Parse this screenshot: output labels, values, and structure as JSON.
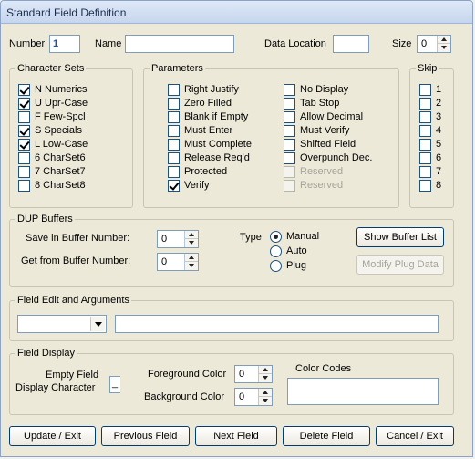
{
  "window": {
    "title": "Standard Field Definition"
  },
  "top": {
    "number_label": "Number",
    "number_value": "1",
    "name_label": "Name",
    "name_value": "",
    "data_location_label": "Data Location",
    "data_location_value": "",
    "size_label": "Size",
    "size_value": "0"
  },
  "character_sets": {
    "legend": "Character Sets",
    "items": [
      {
        "label": "N  Numerics",
        "checked": true
      },
      {
        "label": "U  Upr-Case",
        "checked": true
      },
      {
        "label": "F  Few-Spcl",
        "checked": false
      },
      {
        "label": "S  Specials",
        "checked": true
      },
      {
        "label": "L  Low-Case",
        "checked": true
      },
      {
        "label": "6  CharSet6",
        "checked": false
      },
      {
        "label": "7  CharSet7",
        "checked": false
      },
      {
        "label": "8  CharSet8",
        "checked": false
      }
    ]
  },
  "parameters": {
    "legend": "Parameters",
    "col1": [
      {
        "label": "Right Justify",
        "checked": false,
        "disabled": false
      },
      {
        "label": "Zero Filled",
        "checked": false,
        "disabled": false
      },
      {
        "label": "Blank if Empty",
        "checked": false,
        "disabled": false
      },
      {
        "label": "Must Enter",
        "checked": false,
        "disabled": false
      },
      {
        "label": "Must Complete",
        "checked": false,
        "disabled": false
      },
      {
        "label": "Release Req'd",
        "checked": false,
        "disabled": false
      },
      {
        "label": "Protected",
        "checked": false,
        "disabled": false
      },
      {
        "label": "Verify",
        "checked": true,
        "disabled": false
      }
    ],
    "col2": [
      {
        "label": "No Display",
        "checked": false,
        "disabled": false
      },
      {
        "label": "Tab Stop",
        "checked": false,
        "disabled": false
      },
      {
        "label": "Allow Decimal",
        "checked": false,
        "disabled": false
      },
      {
        "label": "Must Verify",
        "checked": false,
        "disabled": false
      },
      {
        "label": "Shifted Field",
        "checked": false,
        "disabled": false
      },
      {
        "label": "Overpunch Dec.",
        "checked": false,
        "disabled": false
      },
      {
        "label": "Reserved",
        "checked": false,
        "disabled": true
      },
      {
        "label": "Reserved",
        "checked": false,
        "disabled": true
      }
    ]
  },
  "skip": {
    "legend": "Skip",
    "items": [
      "1",
      "2",
      "3",
      "4",
      "5",
      "6",
      "7",
      "8"
    ]
  },
  "dup_buffers": {
    "legend": "DUP Buffers",
    "save_label": "Save in Buffer Number:",
    "save_value": "0",
    "get_label": "Get from Buffer Number:",
    "get_value": "0",
    "type_label": "Type",
    "types": [
      {
        "label": "Manual",
        "selected": true
      },
      {
        "label": "Auto",
        "selected": false
      },
      {
        "label": "Plug",
        "selected": false
      }
    ],
    "show_buffer_list": "Show Buffer List",
    "modify_plug_data": "Modify Plug Data"
  },
  "field_edit": {
    "legend": "Field Edit and Arguments",
    "combo_value": "",
    "args_value": ""
  },
  "field_display": {
    "legend": "Field Display",
    "empty_field_label_1": "Empty Field",
    "empty_field_label_2": "Display Character",
    "empty_char_value": "_",
    "foreground_label": "Foreground Color",
    "foreground_value": "0",
    "background_label": "Background Color",
    "background_value": "0",
    "color_codes_label": "Color Codes"
  },
  "buttons": {
    "update_exit": "Update / Exit",
    "previous_field": "Previous Field",
    "next_field": "Next Field",
    "delete_field": "Delete Field",
    "cancel_exit": "Cancel / Exit"
  },
  "colors": {
    "checkmark": "#21a121",
    "face": "#ece9d8",
    "title_text": "#1b2b4c"
  }
}
